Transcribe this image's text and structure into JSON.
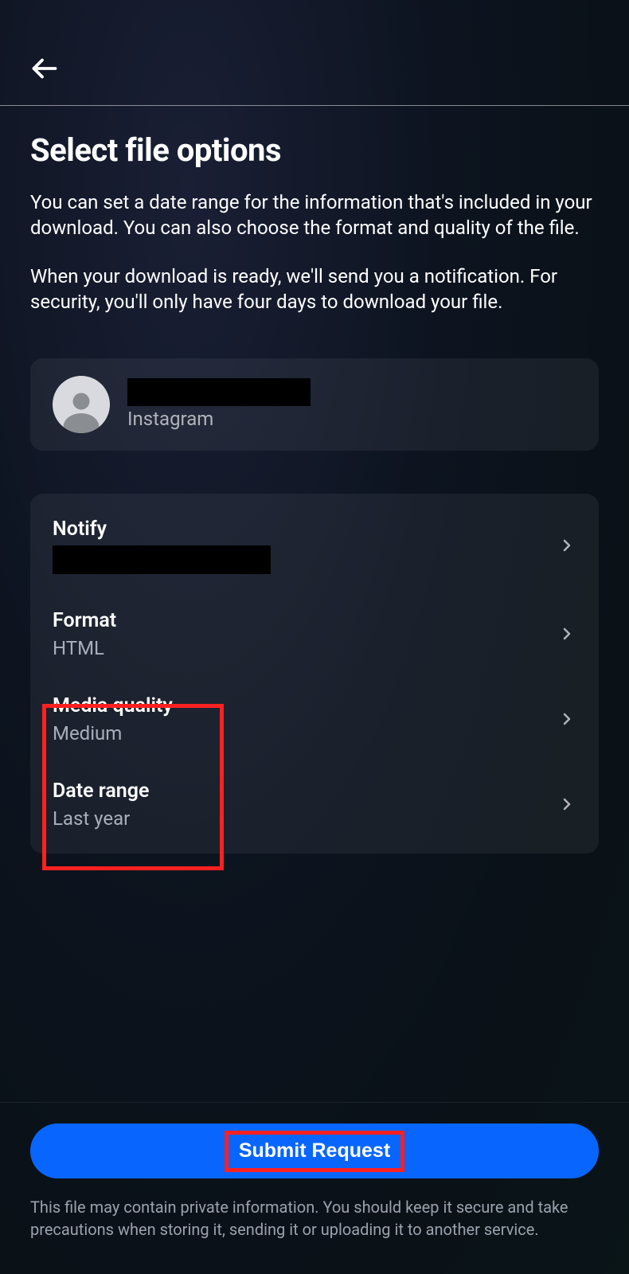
{
  "header": {
    "title": "Select file options",
    "description1": "You can set a date range for the information that's included in your download. You can also choose the format and quality of the file.",
    "description2": "When your download is ready, we'll send you a notification. For security, you'll only have four days to download your file."
  },
  "account": {
    "platform": "Instagram"
  },
  "options": {
    "notify": {
      "label": "Notify"
    },
    "format": {
      "label": "Format",
      "value": "HTML"
    },
    "mediaQuality": {
      "label": "Media quality",
      "value": "Medium"
    },
    "dateRange": {
      "label": "Date range",
      "value": "Last year"
    }
  },
  "footer": {
    "submitLabel": "Submit Request",
    "disclaimer": "This file may contain private information. You should keep it secure and take precautions when storing it, sending it or uploading it to another service."
  }
}
